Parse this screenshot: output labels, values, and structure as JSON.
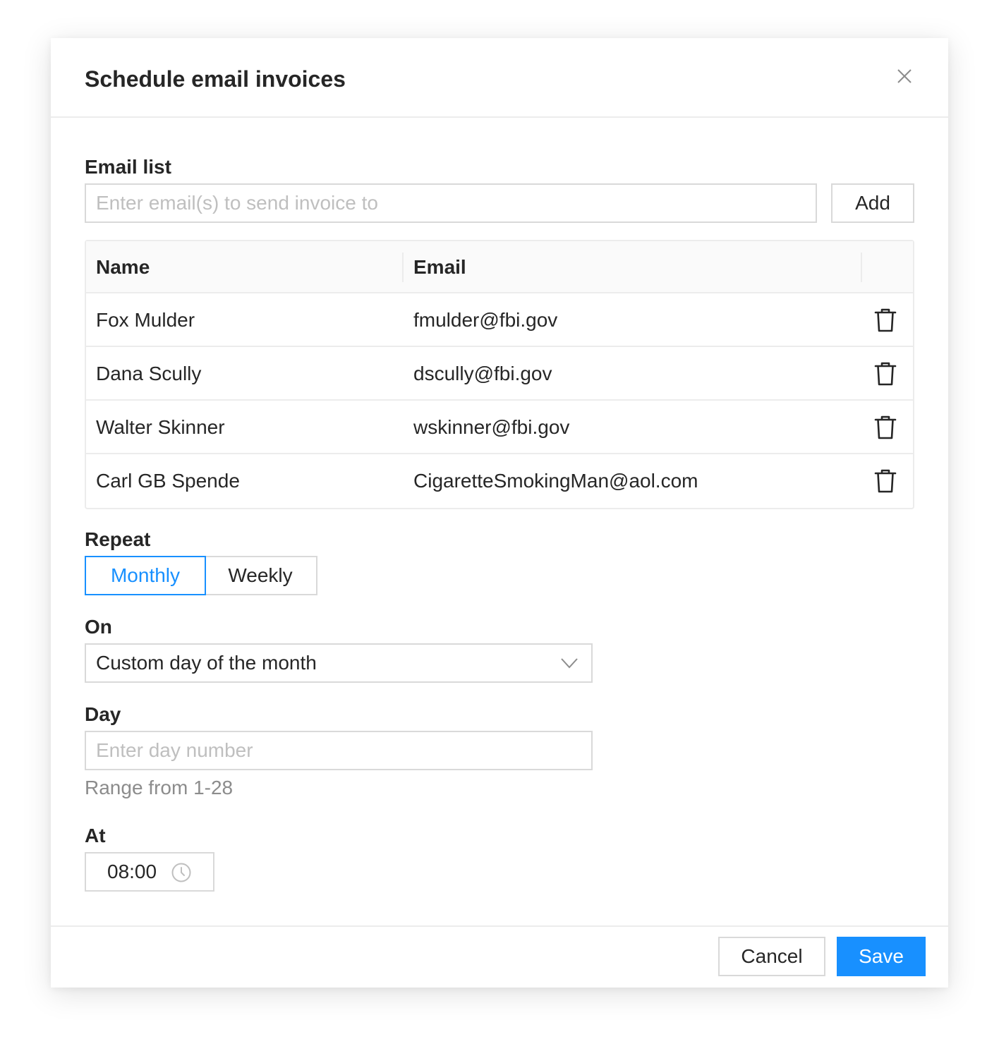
{
  "dialog": {
    "title": "Schedule email invoices"
  },
  "email_list": {
    "label": "Email list",
    "placeholder": "Enter email(s) to send invoice to",
    "add_label": "Add"
  },
  "table": {
    "columns": [
      "Name",
      "Email"
    ],
    "rows": [
      {
        "name": "Fox Mulder",
        "email": "fmulder@fbi.gov"
      },
      {
        "name": "Dana Scully",
        "email": "dscully@fbi.gov"
      },
      {
        "name": "Walter Skinner",
        "email": "wskinner@fbi.gov"
      },
      {
        "name": "Carl GB Spende",
        "email": "CigaretteSmokingMan@aol.com"
      }
    ],
    "row_action_icon": "trash-icon"
  },
  "repeat": {
    "label": "Repeat",
    "options": [
      "Monthly",
      "Weekly"
    ],
    "selected": "Monthly"
  },
  "on": {
    "label": "On",
    "value": "Custom day of the month"
  },
  "day": {
    "label": "Day",
    "placeholder": "Enter day number",
    "help": "Range from 1-28"
  },
  "at": {
    "label": "At",
    "value": "08:00"
  },
  "footer": {
    "cancel_label": "Cancel",
    "save_label": "Save"
  },
  "colors": {
    "primary": "#1890ff",
    "border": "#d9d9d9",
    "text": "#262626",
    "placeholder": "#bfbfbf",
    "help": "#8c8c8c"
  }
}
